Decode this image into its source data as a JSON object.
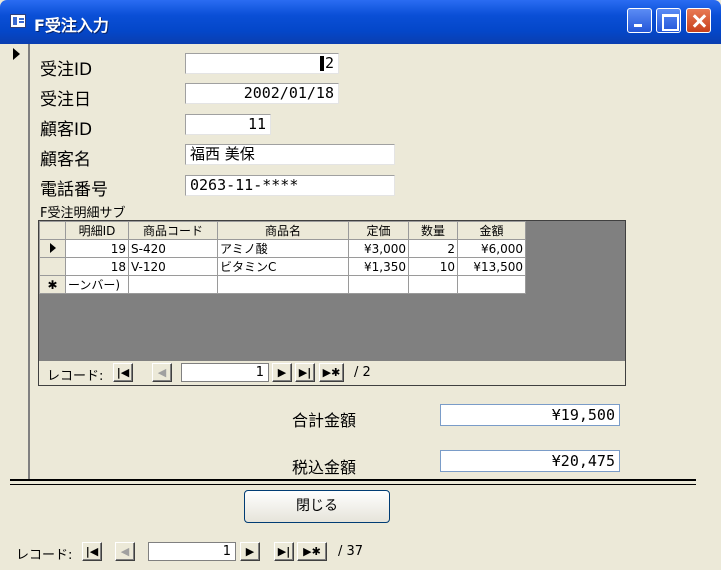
{
  "window": {
    "title": "F受注入力"
  },
  "form": {
    "fields": [
      {
        "label": "受注ID",
        "value": "2"
      },
      {
        "label": "受注日",
        "value": "2002/01/18"
      },
      {
        "label": "顧客ID",
        "value": "11"
      },
      {
        "label": "顧客名",
        "value": "福西 美保"
      },
      {
        "label": "電話番号",
        "value": "0263-11-****"
      }
    ]
  },
  "subform": {
    "label": "F受注明細サブ",
    "columns": [
      "明細ID",
      "商品コード",
      "商品名",
      "定価",
      "数量",
      "金額"
    ],
    "rows": [
      {
        "id": "19",
        "code": "S-420",
        "name": "アミノ酸",
        "price": "¥3,000",
        "qty": "2",
        "amount": "¥6,000"
      },
      {
        "id": "18",
        "code": "V-120",
        "name": "ビタミンC",
        "price": "¥1,350",
        "qty": "10",
        "amount": "¥13,500"
      }
    ],
    "new_row_id": "ーンバー)",
    "nav": {
      "label": "レコード:",
      "current": "1",
      "total": "/ 2"
    }
  },
  "totals": {
    "sum_label": "合計金額",
    "sum_value": "¥19,500",
    "tax_label": "税込金額",
    "tax_value": "¥20,475"
  },
  "close_button_label": "閉じる",
  "main_nav": {
    "label": "レコード:",
    "current": "1",
    "total": "/ 37"
  },
  "icons": {
    "first": "first-record-icon",
    "prev": "prev-record-icon",
    "next": "next-record-icon",
    "last": "last-record-icon",
    "new": "new-record-icon"
  }
}
